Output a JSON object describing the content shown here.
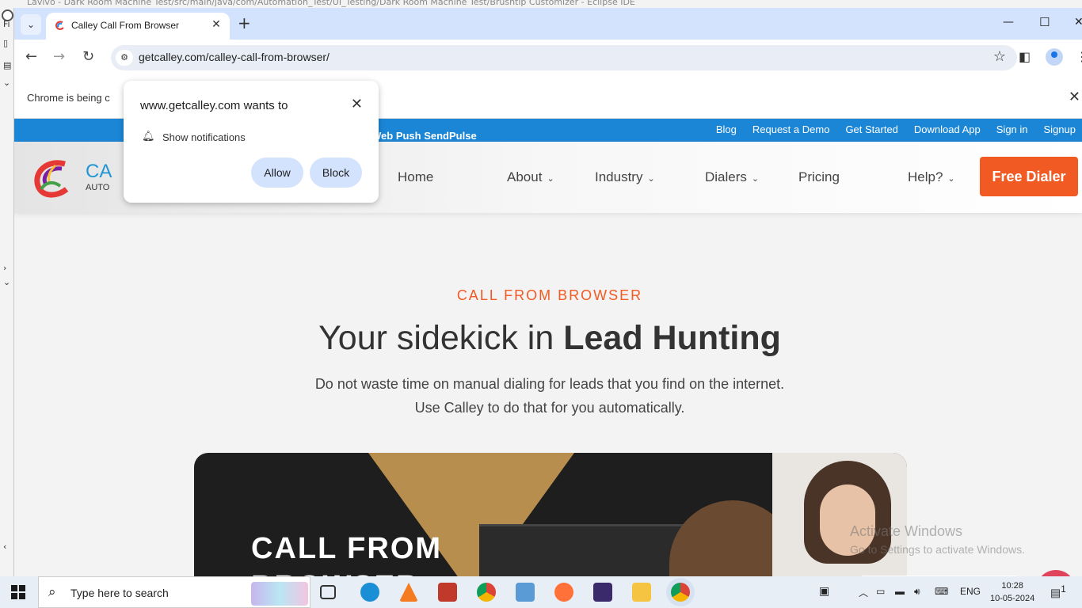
{
  "ide": {
    "title_fragment": "Lavivo - Dark Room Machine Test/src/main/java/com/Automation_Test/UI_Testing/Dark Room Machine Test/Brushtip Customizer - Eclipse IDE",
    "menu_fragment": "Fi"
  },
  "browser": {
    "tab_title": "Calley Call From Browser",
    "url": "getcalley.com/calley-call-from-browser/",
    "infobar_text": "Chrome is being c"
  },
  "popup": {
    "title": "www.getcalley.com wants to",
    "permission": "Show notifications",
    "allow_label": "Allow",
    "block_label": "Block"
  },
  "site": {
    "push_label": "Web Push  SendPulse",
    "top_links": [
      "Blog",
      "Request a Demo",
      "Get Started",
      "Download App",
      "Sign in",
      "Signup"
    ],
    "logo_text": "CA",
    "logo_sub": "AUTO",
    "nav": {
      "home": "Home",
      "about": "About",
      "industry": "Industry",
      "dialers": "Dialers",
      "pricing": "Pricing",
      "help": "Help?"
    },
    "cta": "Free Dialer",
    "eyebrow": "CALL FROM BROWSER",
    "headline_pre": "Your sidekick in ",
    "headline_bold": "Lead Hunting",
    "sub_line1": "Do not waste time on manual dialing for leads that you find on the internet.",
    "sub_line2": "Use Calley to do that for you automatically.",
    "banner_text1": "CALL FROM",
    "banner_text2": "BROWSER"
  },
  "watermark": {
    "line1": "Activate Windows",
    "line2": "Go to Settings to activate Windows."
  },
  "taskbar": {
    "search_placeholder": "Type here to search",
    "lang": "ENG",
    "time": "10:28",
    "date": "10-05-2024",
    "notif_count": "1"
  }
}
